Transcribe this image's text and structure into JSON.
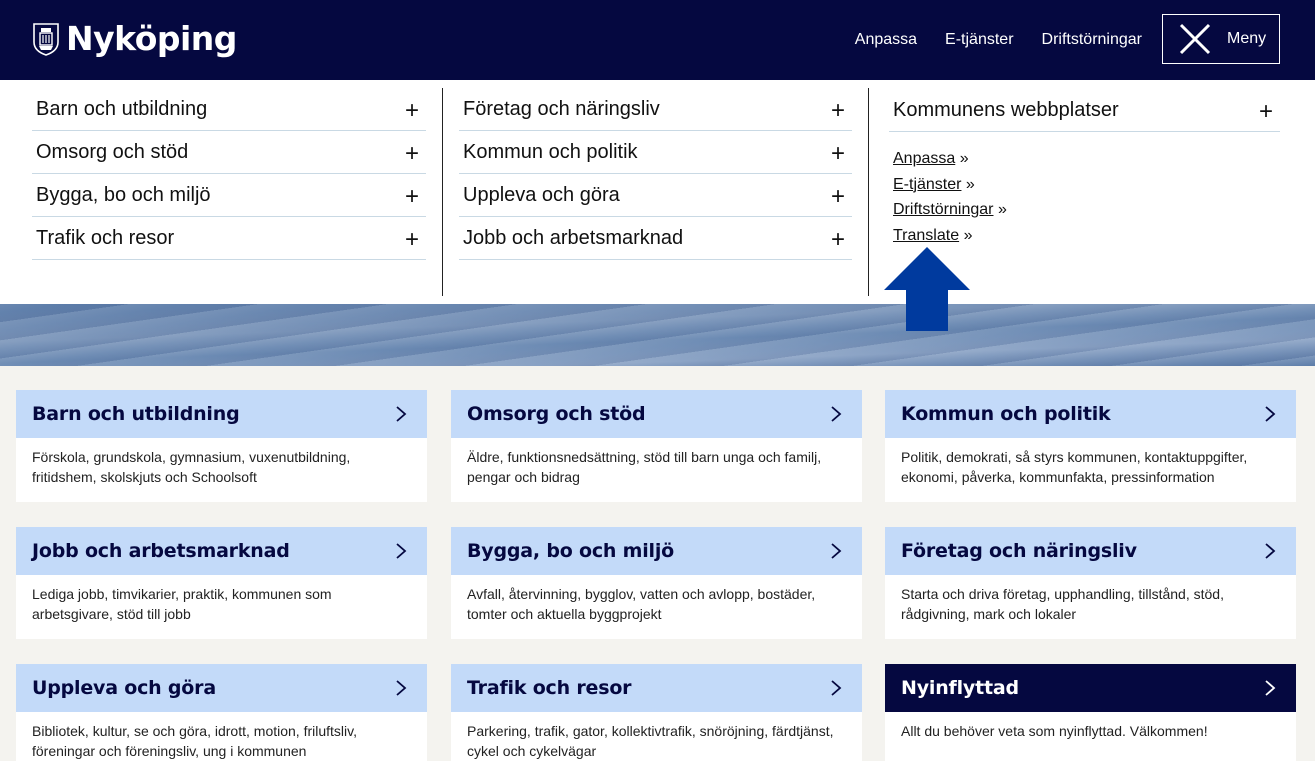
{
  "header": {
    "logo_text": "Nyköping",
    "links": [
      "Anpassa",
      "E-tjänster",
      "Driftstörningar"
    ],
    "menu_label": "Meny"
  },
  "mega_menu": {
    "col1": [
      "Barn och utbildning",
      "Omsorg och stöd",
      "Bygga, bo och miljö",
      "Trafik och resor"
    ],
    "col2": [
      "Företag och näringsliv",
      "Kommun och politik",
      "Uppleva och göra",
      "Jobb och arbetsmarknad"
    ],
    "col3_title": "Kommunens webbplatser",
    "col3_links": [
      "Anpassa",
      "E-tjänster",
      "Driftstörningar",
      "Translate"
    ],
    "link_suffix": "»",
    "plus": "+"
  },
  "cards": [
    {
      "title": "Barn och utbildning",
      "desc": "Förskola, grundskola, gymnasium, vuxenutbildning, fritidshem, skolskjuts och Schoolsoft"
    },
    {
      "title": "Omsorg och stöd",
      "desc": "Äldre, funktionsnedsättning, stöd till barn unga och familj, pengar och bidrag"
    },
    {
      "title": "Kommun och politik",
      "desc": "Politik, demokrati, så styrs kommunen, kontaktuppgifter, ekonomi, påverka, kommunfakta, pressinformation"
    },
    {
      "title": "Jobb och arbetsmarknad",
      "desc": "Lediga jobb, timvikarier, praktik, kommunen som arbetsgivare, stöd till jobb"
    },
    {
      "title": "Bygga, bo och miljö",
      "desc": "Avfall, återvinning, bygglov, vatten och avlopp, bostäder, tomter och aktuella byggprojekt"
    },
    {
      "title": "Företag och näringsliv",
      "desc": "Starta och driva företag, upphandling, tillstånd, stöd, rådgivning, mark och lokaler"
    },
    {
      "title": "Uppleva och göra",
      "desc": "Bibliotek, kultur, se och göra, idrott, motion, friluftsliv, föreningar och föreningsliv, ung i kommunen"
    },
    {
      "title": "Trafik och resor",
      "desc": "Parkering, trafik, gator, kollektivtrafik, snöröjning, färdtjänst, cykel och cykelvägar"
    },
    {
      "title": "Nyinflyttad",
      "desc": "Allt du behöver veta som nyinflyttad. Välkommen!"
    }
  ],
  "colors": {
    "header_bg": "#050840",
    "card_head": "#c3daf9",
    "arrow": "#003a9e",
    "page_bg": "#f4f3ef"
  },
  "icons": [
    "crest-icon",
    "close-icon",
    "plus-icon",
    "chevron-right-icon",
    "arrow-up-icon"
  ]
}
